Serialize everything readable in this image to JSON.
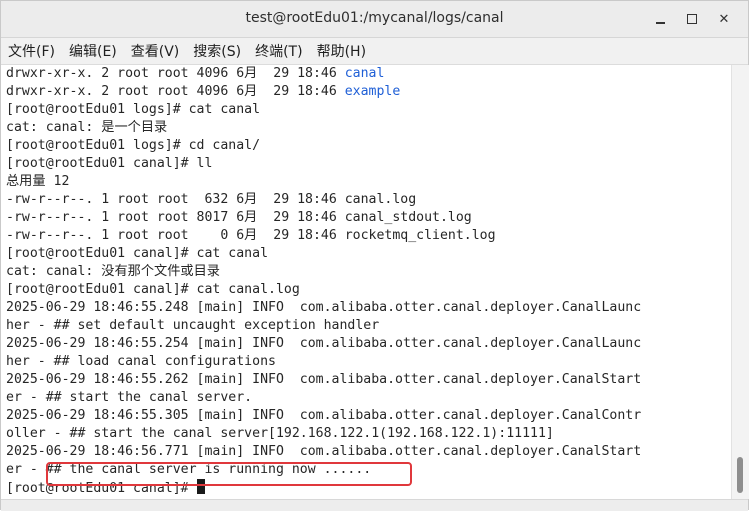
{
  "window": {
    "title": "test@rootEdu01:/mycanal/logs/canal"
  },
  "menubar": {
    "items": [
      "文件(F)",
      "编辑(E)",
      "查看(V)",
      "搜索(S)",
      "终端(T)",
      "帮助(H)"
    ]
  },
  "terminal": {
    "lines": [
      {
        "pre": "drwxr-xr-x. 2 root root 4096 6月  29 18:46 ",
        "colored": "canal"
      },
      {
        "pre": "drwxr-xr-x. 2 root root 4096 6月  29 18:46 ",
        "colored": "example"
      },
      {
        "pre": "[root@rootEdu01 logs]# cat canal"
      },
      {
        "pre": "cat: canal: 是一个目录"
      },
      {
        "pre": "[root@rootEdu01 logs]# cd canal/"
      },
      {
        "pre": "[root@rootEdu01 canal]# ll"
      },
      {
        "pre": "总用量 12"
      },
      {
        "pre": "-rw-r--r--. 1 root root  632 6月  29 18:46 canal.log"
      },
      {
        "pre": "-rw-r--r--. 1 root root 8017 6月  29 18:46 canal_stdout.log"
      },
      {
        "pre": "-rw-r--r--. 1 root root    0 6月  29 18:46 rocketmq_client.log"
      },
      {
        "pre": "[root@rootEdu01 canal]# cat canal"
      },
      {
        "pre": "cat: canal: 没有那个文件或目录"
      },
      {
        "pre": "[root@rootEdu01 canal]# cat canal.log"
      },
      {
        "pre": "2025-06-29 18:46:55.248 [main] INFO  com.alibaba.otter.canal.deployer.CanalLaunc"
      },
      {
        "pre": "her - ## set default uncaught exception handler"
      },
      {
        "pre": "2025-06-29 18:46:55.254 [main] INFO  com.alibaba.otter.canal.deployer.CanalLaunc"
      },
      {
        "pre": "her - ## load canal configurations"
      },
      {
        "pre": "2025-06-29 18:46:55.262 [main] INFO  com.alibaba.otter.canal.deployer.CanalStart"
      },
      {
        "pre": "er - ## start the canal server."
      },
      {
        "pre": "2025-06-29 18:46:55.305 [main] INFO  com.alibaba.otter.canal.deployer.CanalContr"
      },
      {
        "pre": "oller - ## start the canal server[192.168.122.1(192.168.122.1):11111]"
      },
      {
        "pre": "2025-06-29 18:46:56.771 [main] INFO  com.alibaba.otter.canal.deployer.CanalStart"
      },
      {
        "pre": "er - ## the canal server is running now ......"
      }
    ],
    "prompt": "[root@rootEdu01 canal]# "
  },
  "colors": {
    "directory": "#1f5fd6",
    "highlight_border": "#e0383c"
  }
}
